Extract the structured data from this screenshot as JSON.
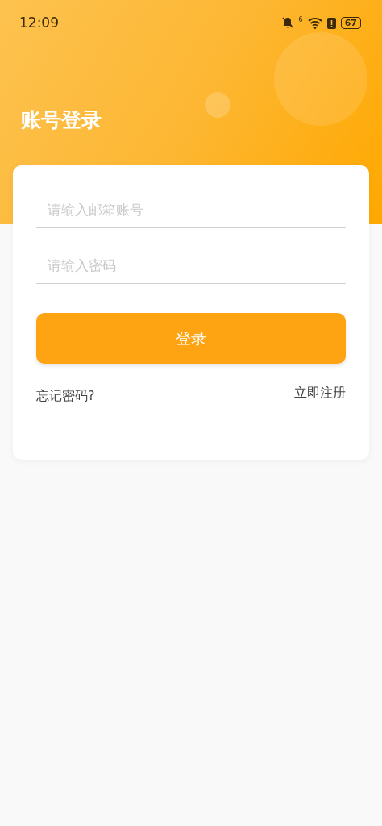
{
  "status_bar": {
    "time": "12:09",
    "signal_label": "6",
    "battery": "67"
  },
  "header": {
    "title": "账号登录"
  },
  "form": {
    "fields": [
      {
        "placeholder": "请输入邮箱账号"
      },
      {
        "placeholder": "请输入密码"
      }
    ],
    "login_button": "登录",
    "forgot_link": "忘记密码?",
    "register_link": "立即注册"
  }
}
